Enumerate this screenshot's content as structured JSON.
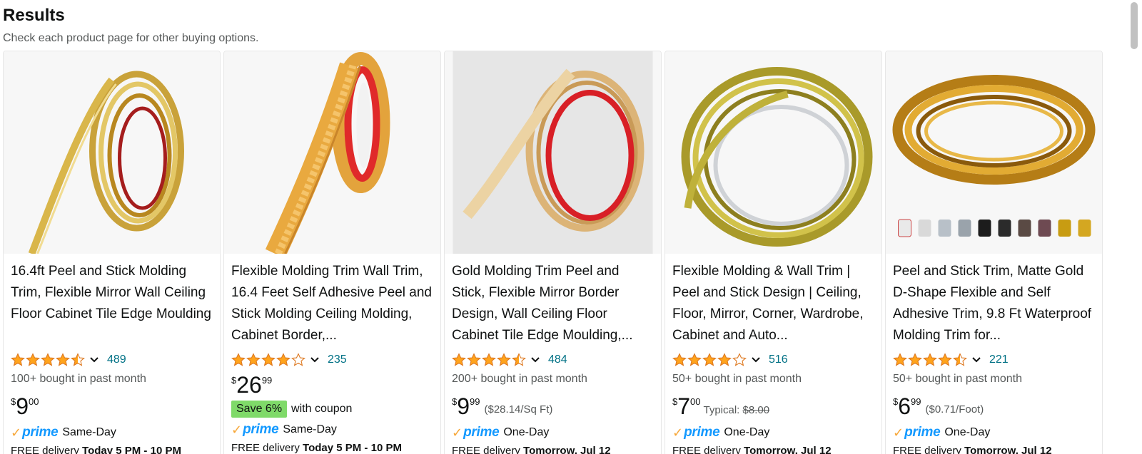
{
  "header": {
    "title": "Results",
    "subtitle": "Check each product page for other buying options."
  },
  "products": [
    {
      "title": "16.4ft Peel and Stick Molding Trim, Flexible Mirror Wall Ceiling Floor Cabinet Tile Edge Moulding",
      "rating": 4.5,
      "reviews": "489",
      "bought": "100+ bought in past month",
      "price_symbol": "$",
      "price_whole": "9",
      "price_fraction": "00",
      "unit_price": "",
      "typical_label": "",
      "typical_price": "",
      "coupon_badge": "",
      "coupon_text": "",
      "prime_label": "prime",
      "delivery_speed": "Same-Day",
      "delivery_text": "FREE delivery ",
      "delivery_date": "Today 5 PM - 10 PM"
    },
    {
      "title": "Flexible Molding Trim Wall Trim, 16.4 Feet Self Adhesive Peel and Stick Molding Ceiling Molding, Cabinet Border,...",
      "rating": 4.0,
      "reviews": "235",
      "bought": "",
      "price_symbol": "$",
      "price_whole": "26",
      "price_fraction": "99",
      "unit_price": "",
      "typical_label": "",
      "typical_price": "",
      "coupon_badge": "Save 6%",
      "coupon_text": "with coupon",
      "prime_label": "prime",
      "delivery_speed": "Same-Day",
      "delivery_text": "FREE delivery ",
      "delivery_date": "Today 5 PM - 10 PM"
    },
    {
      "title": "Gold Molding Trim Peel and Stick, Flexible Mirror Border Design, Wall Ceiling Floor Cabinet Tile Edge Moulding,...",
      "rating": 4.5,
      "reviews": "484",
      "bought": "200+ bought in past month",
      "price_symbol": "$",
      "price_whole": "9",
      "price_fraction": "99",
      "unit_price": "($28.14/Sq Ft)",
      "typical_label": "",
      "typical_price": "",
      "coupon_badge": "",
      "coupon_text": "",
      "prime_label": "prime",
      "delivery_speed": "One-Day",
      "delivery_text": "FREE delivery ",
      "delivery_date": "Tomorrow, Jul 12"
    },
    {
      "title": "Flexible Molding & Wall Trim | Peel and Stick Design | Ceiling, Floor, Mirror, Corner, Wardrobe, Cabinet and Auto...",
      "rating": 4.0,
      "reviews": "516",
      "bought": "50+ bought in past month",
      "price_symbol": "$",
      "price_whole": "7",
      "price_fraction": "00",
      "unit_price": "",
      "typical_label": "Typical: ",
      "typical_price": "$8.00",
      "coupon_badge": "",
      "coupon_text": "",
      "prime_label": "prime",
      "delivery_speed": "One-Day",
      "delivery_text": "FREE delivery ",
      "delivery_date": "Tomorrow, Jul 12"
    },
    {
      "title": "Peel and Stick Trim, Matte Gold D-Shape Flexible and Self Adhesive Trim, 9.8 Ft Waterproof Molding Trim for...",
      "rating": 4.5,
      "reviews": "221",
      "bought": "50+ bought in past month",
      "price_symbol": "$",
      "price_whole": "6",
      "price_fraction": "99",
      "unit_price": "($0.71/Foot)",
      "typical_label": "",
      "typical_price": "",
      "coupon_badge": "",
      "coupon_text": "",
      "prime_label": "prime",
      "delivery_speed": "One-Day",
      "delivery_text": "FREE delivery ",
      "delivery_date": "Tomorrow, Jul 12"
    }
  ],
  "colors": {
    "star": "#FFA41C",
    "link": "#007185",
    "prime_blue": "#1399FF",
    "prime_check": "#F7A738",
    "coupon_green": "#7FDA69"
  },
  "icons": {
    "star": "star-icon",
    "half_star": "half-star-icon",
    "empty_star": "empty-star-icon",
    "chevron": "chevron-down-icon",
    "prime_check": "prime-check-icon"
  }
}
